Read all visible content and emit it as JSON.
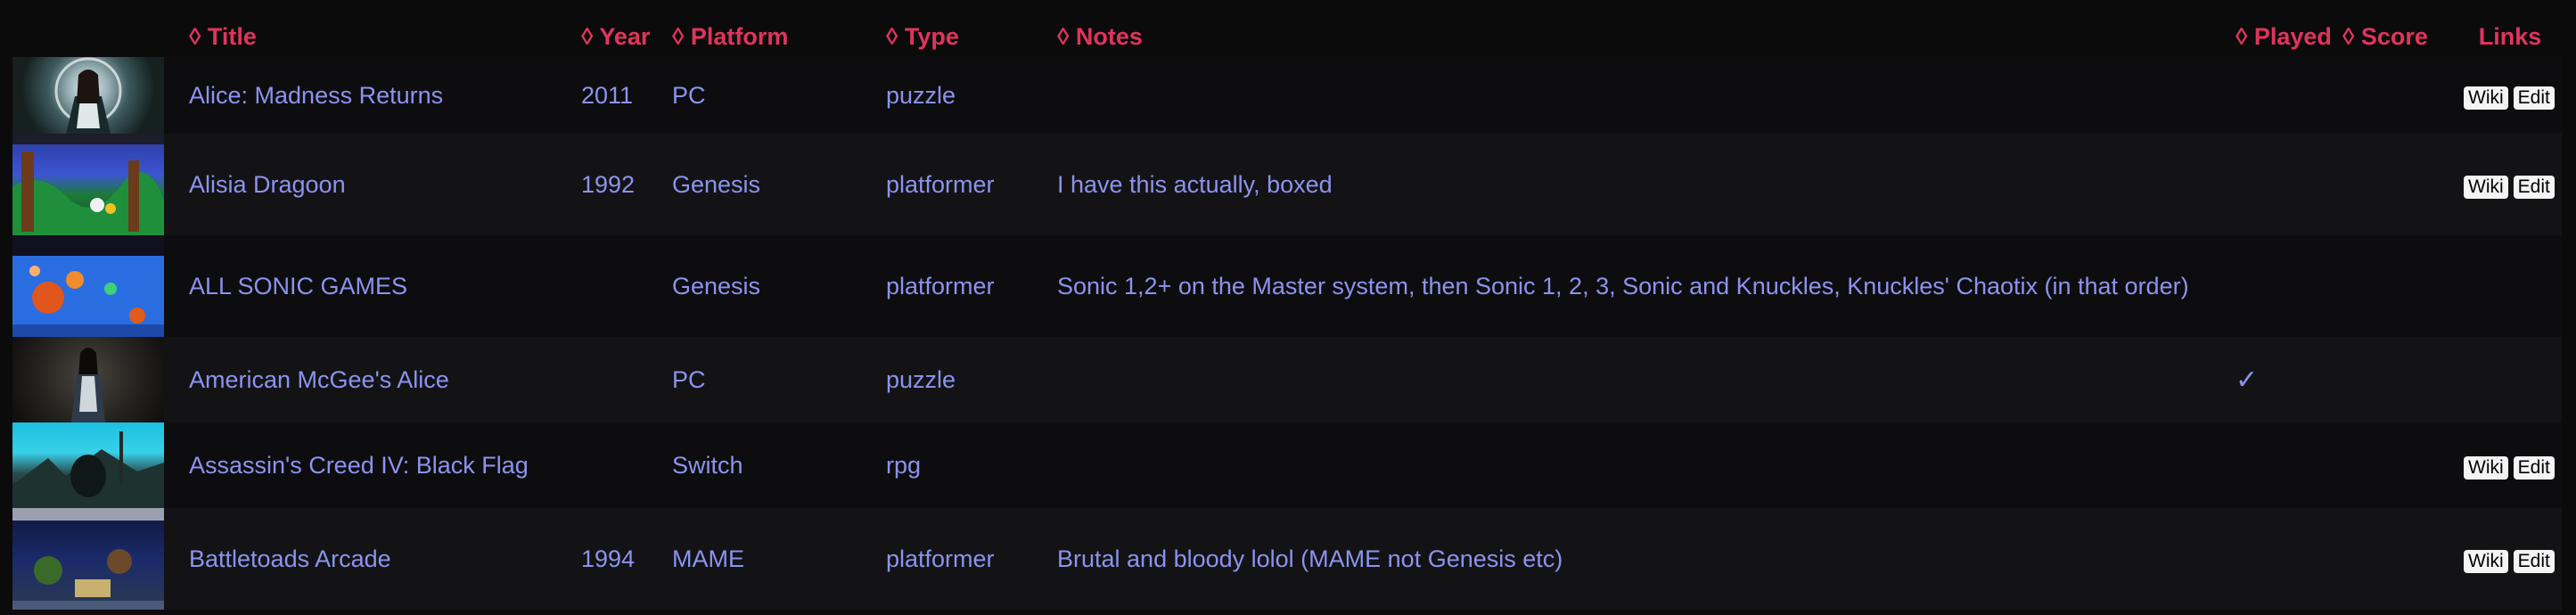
{
  "headers": {
    "title": "◊ Title",
    "year": "◊ Year",
    "platform": "◊ Platform",
    "type": "◊ Type",
    "notes": "◊ Notes",
    "played": "◊ Played",
    "score": "◊ Score",
    "links": "Links"
  },
  "link_labels": {
    "wiki": "Wiki",
    "edit": "Edit"
  },
  "rows": [
    {
      "title": "Alice: Madness Returns",
      "year": "2011",
      "platform": "PC",
      "type": "puzzle",
      "notes": "",
      "played": "",
      "score": ""
    },
    {
      "title": "Alisia Dragoon",
      "year": "1992",
      "platform": "Genesis",
      "type": "platformer",
      "notes": "I have this actually, boxed",
      "played": "",
      "score": ""
    },
    {
      "title": "ALL SONIC GAMES",
      "year": "",
      "platform": "Genesis",
      "type": "platformer",
      "notes": "Sonic 1,2+ on the Master system, then Sonic 1, 2, 3, Sonic and Knuckles, Knuckles' Chaotix (in that order)",
      "played": "",
      "score": ""
    },
    {
      "title": "American McGee's Alice",
      "year": "",
      "platform": "PC",
      "type": "puzzle",
      "notes": "",
      "played": "✓",
      "score": ""
    },
    {
      "title": "Assassin's Creed IV: Black Flag",
      "year": "",
      "platform": "Switch",
      "type": "rpg",
      "notes": "",
      "played": "",
      "score": ""
    },
    {
      "title": "Battletoads Arcade",
      "year": "1994",
      "platform": "MAME",
      "type": "platformer",
      "notes": "Brutal and bloody lolol (MAME not Genesis etc)",
      "played": "",
      "score": ""
    }
  ]
}
